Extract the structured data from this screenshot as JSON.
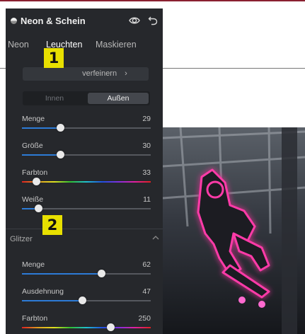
{
  "panel": {
    "title": "Neon & Schein",
    "icons": {
      "title": "neon-glow-icon",
      "eye": "eye-icon",
      "undo": "undo-icon"
    },
    "tabs": [
      {
        "label": "Neon",
        "active": false
      },
      {
        "label": "Leuchten",
        "active": true
      },
      {
        "label": "Maskieren",
        "active": false
      }
    ],
    "refine_button": {
      "label": "verfeinern",
      "chevron": "›"
    },
    "segment": {
      "inner": "Innen",
      "outer": "Außen",
      "selected": "Außen"
    },
    "glow_sliders": [
      {
        "label": "Menge",
        "value": "29",
        "fraction": 0.3
      },
      {
        "label": "Größe",
        "value": "30",
        "fraction": 0.3
      },
      {
        "label": "Farbton",
        "value": "33",
        "fraction": 0.11
      },
      {
        "label": "Weiße",
        "value": "11",
        "fraction": 0.13
      }
    ],
    "glitter": {
      "label": "Glitzer",
      "sliders": [
        {
          "label": "Menge",
          "value": "62",
          "fraction": 0.62
        },
        {
          "label": "Ausdehnung",
          "value": "47",
          "fraction": 0.47
        },
        {
          "label": "Farbton",
          "value": "250",
          "fraction": 0.69
        }
      ]
    }
  },
  "badges": [
    "1",
    "2"
  ],
  "colors": {
    "panel_bg": "#26282c",
    "accent_blue": "#2d7bd6",
    "badge_yellow": "#e8e000",
    "neon_pink": "#ff3aa8",
    "top_rule": "#8a2030"
  }
}
